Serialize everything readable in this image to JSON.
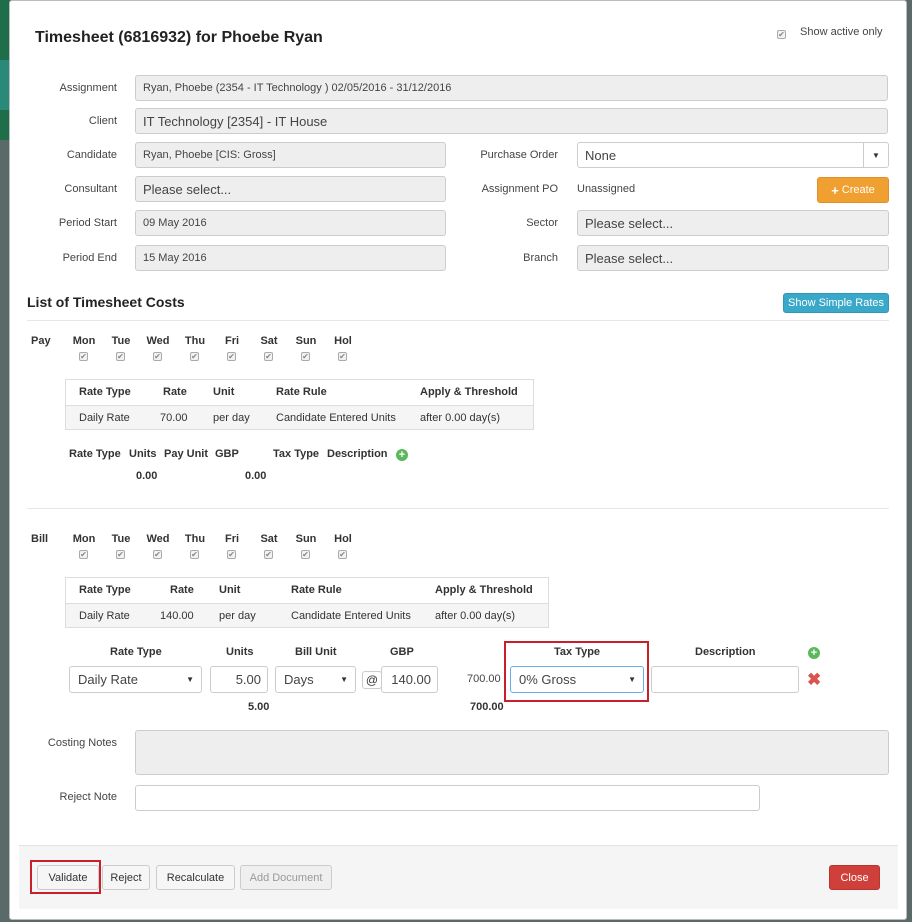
{
  "header": {
    "title": "Timesheet (6816932) for Phoebe Ryan",
    "show_active_label": "Show active only"
  },
  "form": {
    "assignment_label": "Assignment",
    "assignment_value": "Ryan, Phoebe (2354 - IT Technology ) 02/05/2016 - 31/12/2016",
    "client_label": "Client",
    "client_value": "IT Technology  [2354] - IT House",
    "candidate_label": "Candidate",
    "candidate_value": "Ryan, Phoebe [CIS: Gross]",
    "consultant_label": "Consultant",
    "consultant_value": "Please select...",
    "period_start_label": "Period Start",
    "period_start_value": "09 May 2016",
    "period_end_label": "Period End",
    "period_end_value": "15 May 2016",
    "purchase_order_label": "Purchase Order",
    "purchase_order_value": "None",
    "assignment_po_label": "Assignment PO",
    "assignment_po_value": "Unassigned",
    "create_label": "Create",
    "sector_label": "Sector",
    "sector_value": "Please select...",
    "branch_label": "Branch",
    "branch_value": "Please select..."
  },
  "costs": {
    "heading": "List of Timesheet Costs",
    "simple_rates_label": "Show Simple Rates"
  },
  "days": [
    "Mon",
    "Tue",
    "Wed",
    "Thu",
    "Fri",
    "Sat",
    "Sun",
    "Hol"
  ],
  "pay": {
    "label": "Pay",
    "rate_headers": [
      "Rate Type",
      "Rate",
      "Unit",
      "Rate Rule",
      "Apply & Threshold"
    ],
    "rate_row": [
      "Daily Rate",
      "70.00",
      "per day",
      "Candidate Entered Units",
      "after 0.00 day(s)"
    ],
    "entry_headers": [
      "Rate Type",
      "Units",
      "Pay Unit",
      "GBP",
      "Tax Type",
      "Description"
    ],
    "units_total": "0.00",
    "gbp_total": "0.00"
  },
  "bill": {
    "label": "Bill",
    "rate_headers": [
      "Rate Type",
      "Rate",
      "Unit",
      "Rate Rule",
      "Apply & Threshold"
    ],
    "rate_row": [
      "Daily Rate",
      "140.00",
      "per day",
      "Candidate Entered Units",
      "after 0.00 day(s)"
    ],
    "entry_headers": [
      "Rate Type",
      "Units",
      "Bill Unit",
      "GBP",
      "Tax Type",
      "Description"
    ],
    "rate_type_value": "Daily Rate",
    "units_value": "5.00",
    "bill_unit_value": "Days",
    "at_sign": "@",
    "gbp_value": "140.00",
    "line_total": "700.00",
    "tax_type_value": "0% Gross",
    "units_total": "5.00",
    "gbp_total": "700.00"
  },
  "notes": {
    "costing_label": "Costing Notes",
    "reject_label": "Reject Note"
  },
  "footer": {
    "validate": "Validate",
    "reject": "Reject",
    "recalculate": "Recalculate",
    "add_document": "Add Document",
    "close": "Close"
  },
  "colors": {
    "create": "#f0a030",
    "simple_rates": "#3aa8c8",
    "close": "#d0403a",
    "highlight": "#c8202a"
  }
}
